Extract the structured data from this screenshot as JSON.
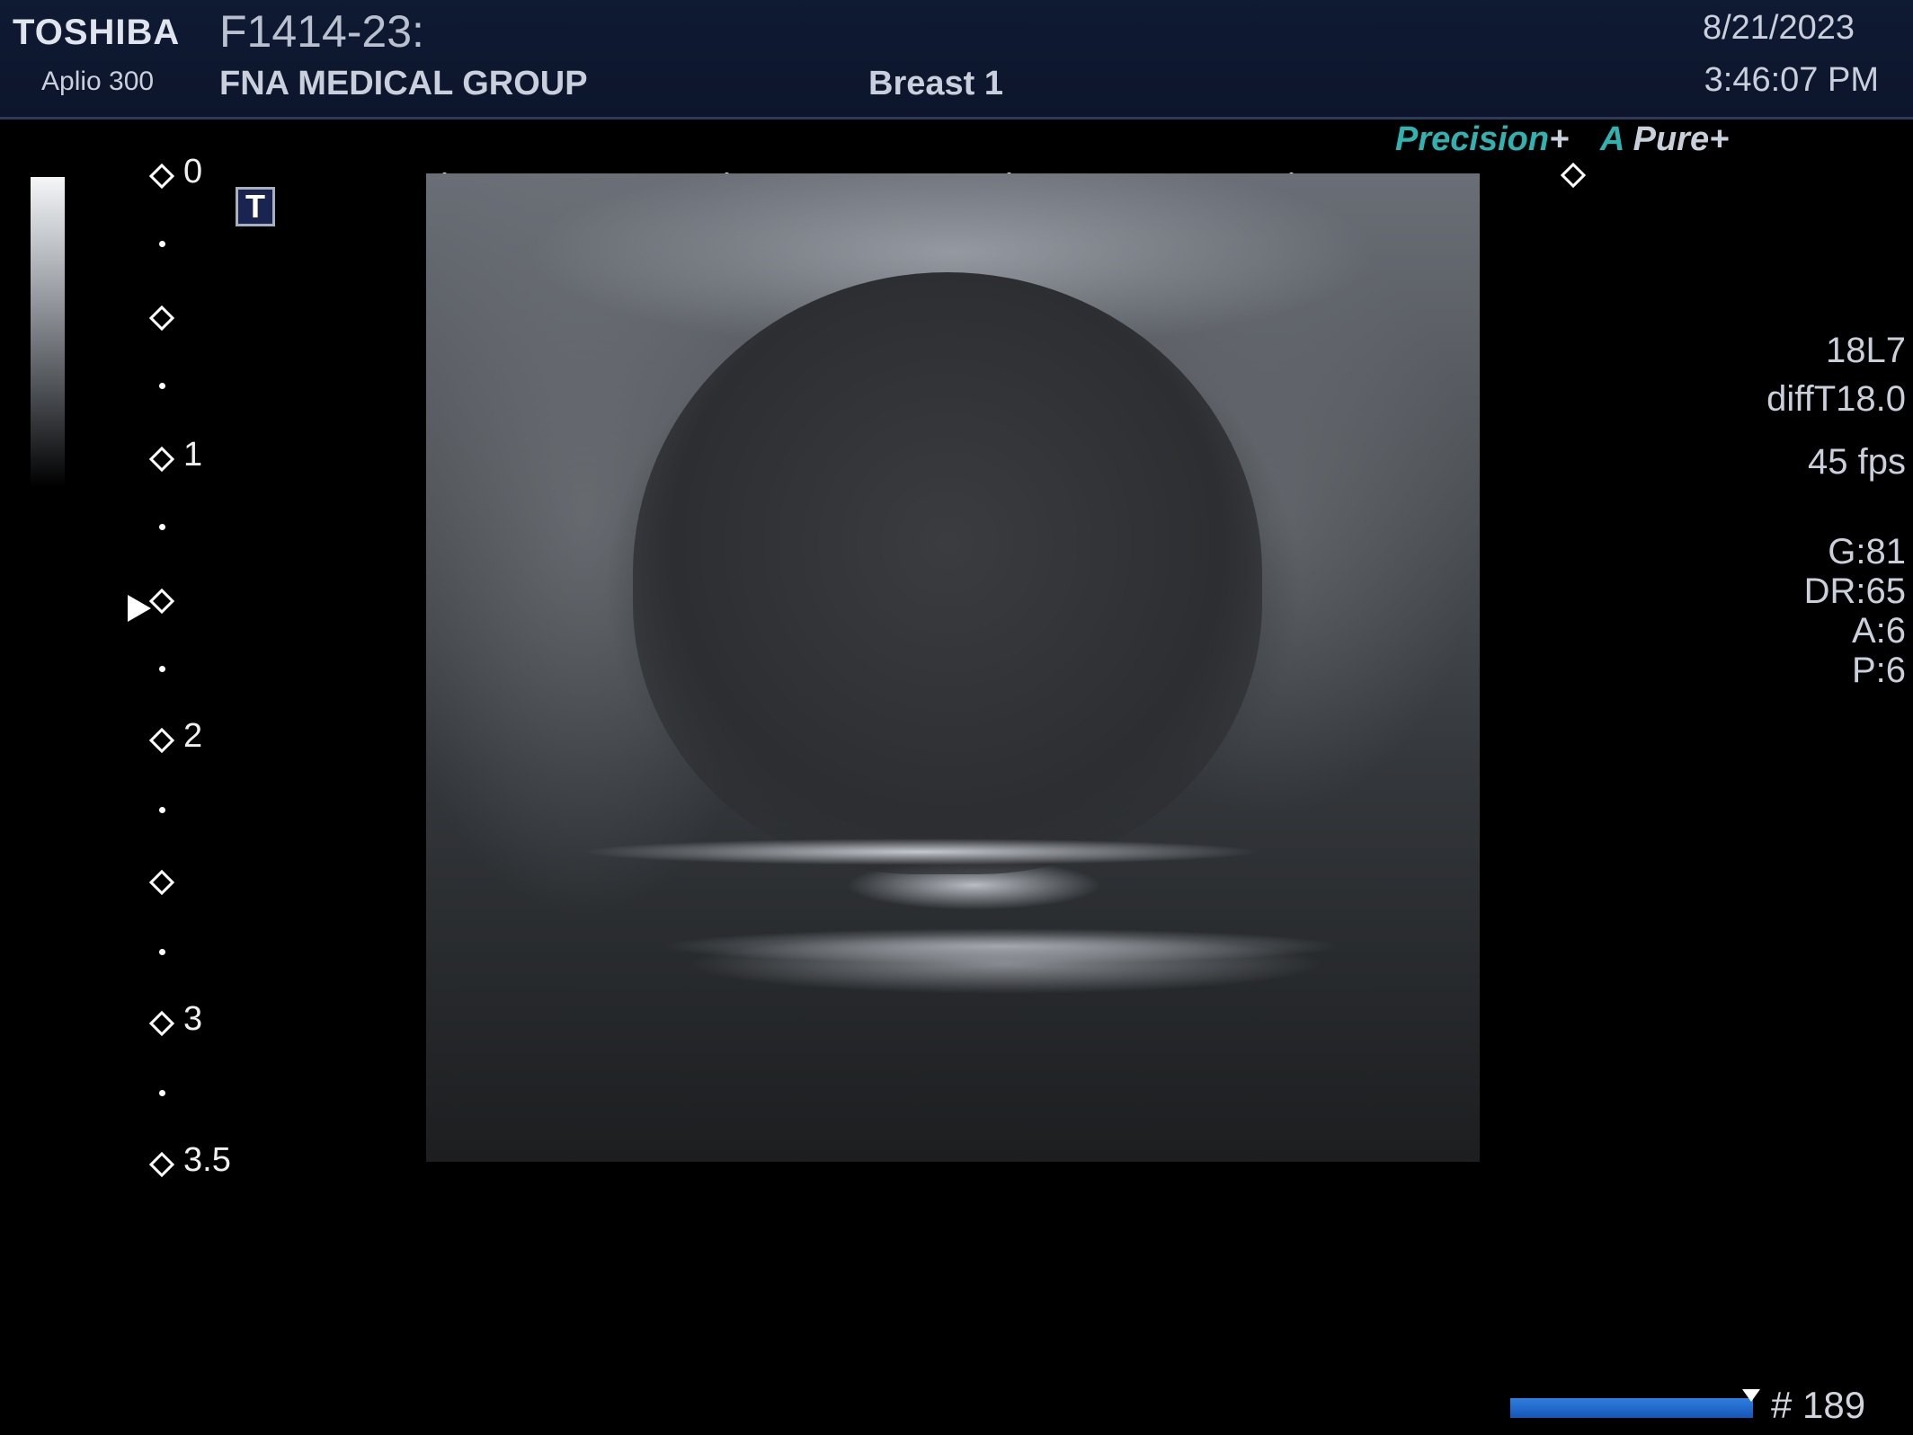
{
  "header": {
    "brand": "TOSHIBA",
    "model": "Aplio 300",
    "patient_id": "F1414-23:",
    "institution": "FNA MEDICAL GROUP",
    "preset": "Breast 1",
    "date": "8/21/2023",
    "time": "3:46:07 PM"
  },
  "features": {
    "precision": "Precision",
    "pure_a": "A",
    "pure_word": "Pure",
    "plus": "+"
  },
  "depth_scale": {
    "labels": [
      "0",
      "1",
      "2",
      "3",
      "3.5"
    ],
    "focus_position_cm": 1.5
  },
  "t_icon": "T",
  "params": {
    "probe": "18L7",
    "mode": "diffT18.0",
    "fps": "45 fps",
    "gain": "G:81",
    "dynamic_range": "DR:65",
    "a": "A:6",
    "p": "P:6"
  },
  "cine": {
    "frame": "# 189",
    "progress": 1.0
  },
  "colors": {
    "header_bg": "#0f1a33",
    "accent_teal": "#2fb3b0",
    "cine_blue": "#2f7fe0"
  }
}
